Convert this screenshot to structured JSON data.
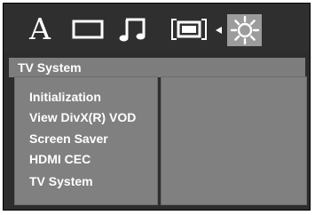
{
  "tabs": [
    {
      "id": "language",
      "label": "A",
      "icon": "letter-a-icon"
    },
    {
      "id": "display",
      "icon": "display-rectangle-icon"
    },
    {
      "id": "audio",
      "icon": "music-note-icon"
    },
    {
      "id": "video",
      "icon": "video-bracket-icon"
    },
    {
      "id": "settings",
      "icon": "sun-gear-icon",
      "selected": true
    }
  ],
  "section_title": "TV System",
  "menu": {
    "items": [
      {
        "label": "Initialization"
      },
      {
        "label": "View DivX(R) VOD"
      },
      {
        "label": "Screen Saver"
      },
      {
        "label": "HDMI CEC"
      },
      {
        "label": "TV System"
      }
    ]
  },
  "colors": {
    "background": "#2d2d2d",
    "selected_tab": "#9c9c9c",
    "title_bar": "#7d7d7d",
    "panel": "#808080",
    "text": "#ffffff"
  }
}
